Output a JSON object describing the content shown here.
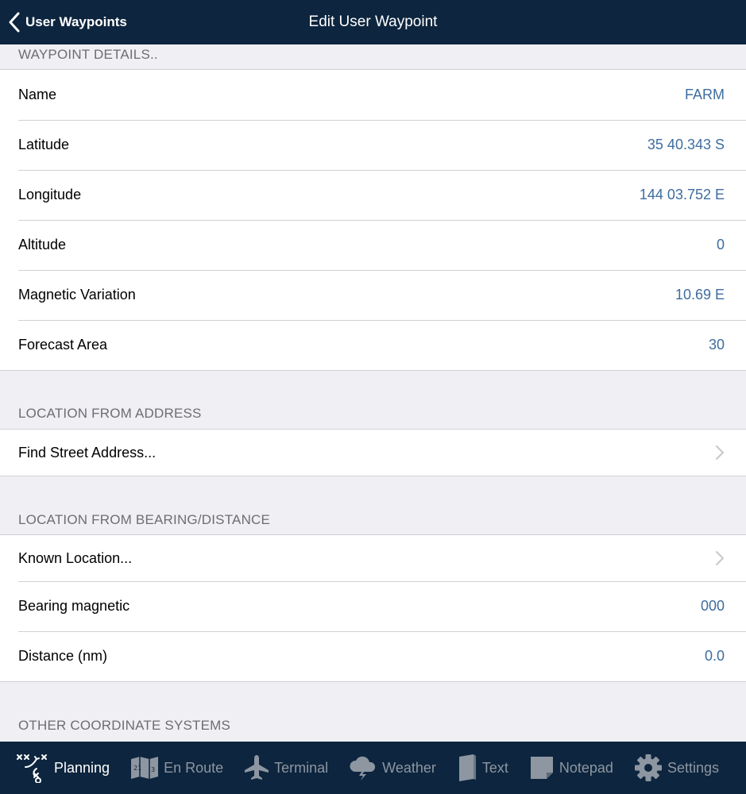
{
  "nav": {
    "back_label": "User Waypoints",
    "title": "Edit User Waypoint"
  },
  "sections": {
    "details": {
      "header": "WAYPOINT DETAILS..",
      "rows": [
        {
          "label": "Name",
          "value": "FARM"
        },
        {
          "label": "Latitude",
          "value": "35 40.343 S"
        },
        {
          "label": "Longitude",
          "value": "144 03.752 E"
        },
        {
          "label": "Altitude",
          "value": "0"
        },
        {
          "label": "Magnetic Variation",
          "value": "10.69 E"
        },
        {
          "label": "Forecast Area",
          "value": "30"
        }
      ]
    },
    "address": {
      "header": "LOCATION FROM ADDRESS",
      "rows": [
        {
          "label": "Find Street Address..."
        }
      ]
    },
    "bearing": {
      "header": "LOCATION FROM BEARING/DISTANCE",
      "rows": [
        {
          "label": "Known Location..."
        },
        {
          "label": "Bearing magnetic",
          "value": "000"
        },
        {
          "label": "Distance (nm)",
          "value": "0.0"
        }
      ]
    },
    "other": {
      "header": "OTHER COORDINATE SYSTEMS"
    }
  },
  "tabs": [
    {
      "label": "Planning",
      "icon": "planning-icon",
      "active": true
    },
    {
      "label": "En Route",
      "icon": "map-icon"
    },
    {
      "label": "Terminal",
      "icon": "airplane-icon"
    },
    {
      "label": "Weather",
      "icon": "weather-cloud-icon"
    },
    {
      "label": "Text",
      "icon": "document-icon"
    },
    {
      "label": "Notepad",
      "icon": "notepad-icon"
    },
    {
      "label": "Settings",
      "icon": "gear-icon"
    }
  ],
  "colors": {
    "bar_background": "#0d253e",
    "value_text": "#3e6d9f",
    "section_background": "#efeff4",
    "tab_inactive": "#8d96a1",
    "tab_active": "#ffffff"
  }
}
